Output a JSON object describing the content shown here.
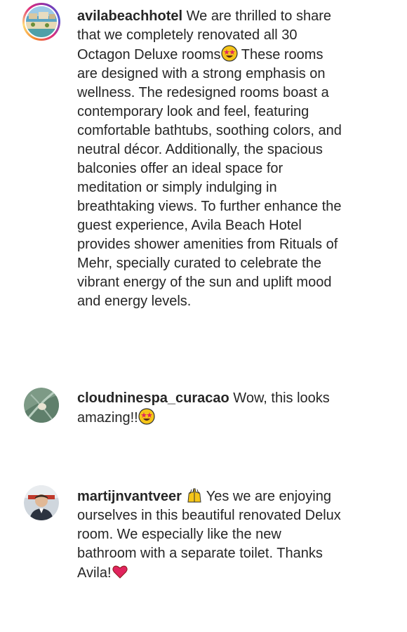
{
  "comments": [
    {
      "username": "avilabeachhotel",
      "text_part1": " We are thrilled to share that we completely renovated all 30 Octagon Deluxe rooms",
      "emoji1": "star-struck",
      "text_part2": " These rooms are designed with a strong emphasis on wellness. The redesigned rooms boast a contemporary look and feel, featuring comfortable bathtubs, soothing colors, and neutral décor. Additionally, the spacious balconies offer an ideal space for meditation or simply indulging in breathtaking views. To further enhance the guest experience, Avila Beach Hotel provides shower amenities from Rituals of Mehr, specially curated to celebrate the vibrant energy of the sun and uplift mood and energy levels."
    },
    {
      "username": "cloudninespa_curacao",
      "text_part1": " Wow, this looks amazing!!",
      "emoji1": "star-struck"
    },
    {
      "username": "martijnvantveer",
      "emoji1": "raising-hands",
      "text_part1": " Yes we are enjoying ourselves in this beautiful renovated Delux room. We especially like the new bathroom with a separate toilet. Thanks Avila!",
      "emoji2": "red-heart"
    }
  ],
  "colors": {
    "text": "#262626",
    "heart": "#e0245e",
    "emoji_face": "#f5c518"
  }
}
